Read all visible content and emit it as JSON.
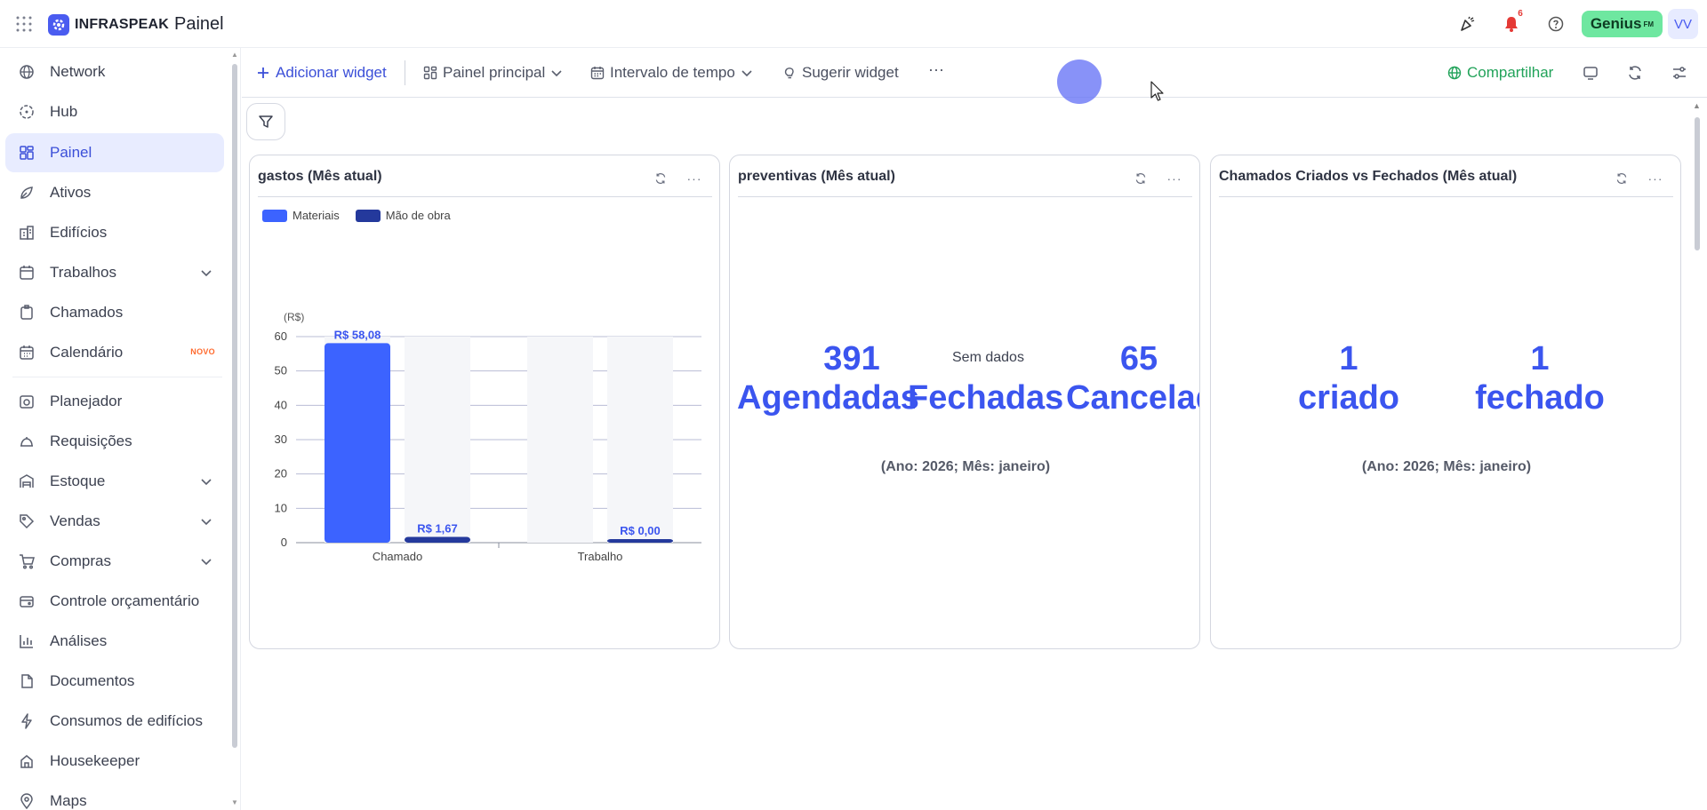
{
  "app": {
    "brand": "INFRASPEAK",
    "title": "Painel",
    "notifications_count": "6",
    "genius_label": "Genius",
    "genius_suffix": "FM",
    "avatar_initials": "VV",
    "accent": "#4a5cf0"
  },
  "sidebar": {
    "items": [
      {
        "label": "Network",
        "icon": "globe-icon"
      },
      {
        "label": "Hub",
        "icon": "hub-icon"
      },
      {
        "label": "Painel",
        "icon": "dashboard-icon",
        "active": true
      },
      {
        "label": "Ativos",
        "icon": "assets-icon"
      },
      {
        "label": "Edifícios",
        "icon": "building-icon"
      },
      {
        "label": "Trabalhos",
        "icon": "work-icon",
        "expandable": true
      },
      {
        "label": "Chamados",
        "icon": "tickets-icon"
      },
      {
        "label": "Calendário",
        "icon": "calendar-icon",
        "badge": "NOVO"
      },
      {
        "label": "Planejador",
        "icon": "planner-icon"
      },
      {
        "label": "Requisições",
        "icon": "requests-icon"
      },
      {
        "label": "Estoque",
        "icon": "stock-icon",
        "expandable": true
      },
      {
        "label": "Vendas",
        "icon": "tag-icon",
        "expandable": true
      },
      {
        "label": "Compras",
        "icon": "cart-icon",
        "expandable": true
      },
      {
        "label": "Controle orçamentário",
        "icon": "budget-icon"
      },
      {
        "label": "Análises",
        "icon": "analytics-icon"
      },
      {
        "label": "Documentos",
        "icon": "documents-icon"
      },
      {
        "label": "Consumos de edifícios",
        "icon": "lightning-icon"
      },
      {
        "label": "Housekeeper",
        "icon": "housekeeper-icon"
      },
      {
        "label": "Maps",
        "icon": "map-pin-icon"
      }
    ]
  },
  "toolbar": {
    "add_widget": "Adicionar widget",
    "main_panel": "Painel principal",
    "time_range": "Intervalo de tempo",
    "suggest_widget": "Sugerir widget",
    "more": "···",
    "share": "Compartilhar"
  },
  "widgets": {
    "gastos": {
      "title": "gastos (Mês atual)",
      "more": "···"
    },
    "preventivas": {
      "title": "preventivas (Mês atual)",
      "more": "···",
      "kpi1_value": "391",
      "kpi1_label": "Agendadas",
      "kpi2_label": "Fechadas",
      "kpi2_status": "Sem dados",
      "kpi3_value": "65",
      "kpi3_label": "Cancelad",
      "footer": "(Ano: 2026; Mês: janeiro)"
    },
    "chamados": {
      "title": "Chamados Criados vs Fechados (Mês atual)",
      "more": "···",
      "kpi1_value": "1",
      "kpi1_label": "criado",
      "kpi2_value": "1",
      "kpi2_label": "fechado",
      "footer": "(Ano: 2026; Mês: janeiro)"
    }
  },
  "chart_data": {
    "type": "bar",
    "title": "gastos (Mês atual)",
    "ylabel": "(R$)",
    "xlabel": "",
    "categories": [
      "Chamado",
      "Trabalho"
    ],
    "ylim": [
      0,
      60
    ],
    "yticks": [
      "0",
      "10",
      "20",
      "30",
      "40",
      "50",
      "60"
    ],
    "series": [
      {
        "name": "Materiais",
        "values": [
          58.08,
          0
        ],
        "labels": [
          "R$ 58,08",
          ""
        ],
        "color": "#3c63ff"
      },
      {
        "name": "Mão de obra",
        "values": [
          1.67,
          0.0
        ],
        "labels": [
          "R$ 1,67",
          "R$ 0,00"
        ],
        "color": "#24399c"
      }
    ],
    "legend": "top-left",
    "grid": true
  }
}
